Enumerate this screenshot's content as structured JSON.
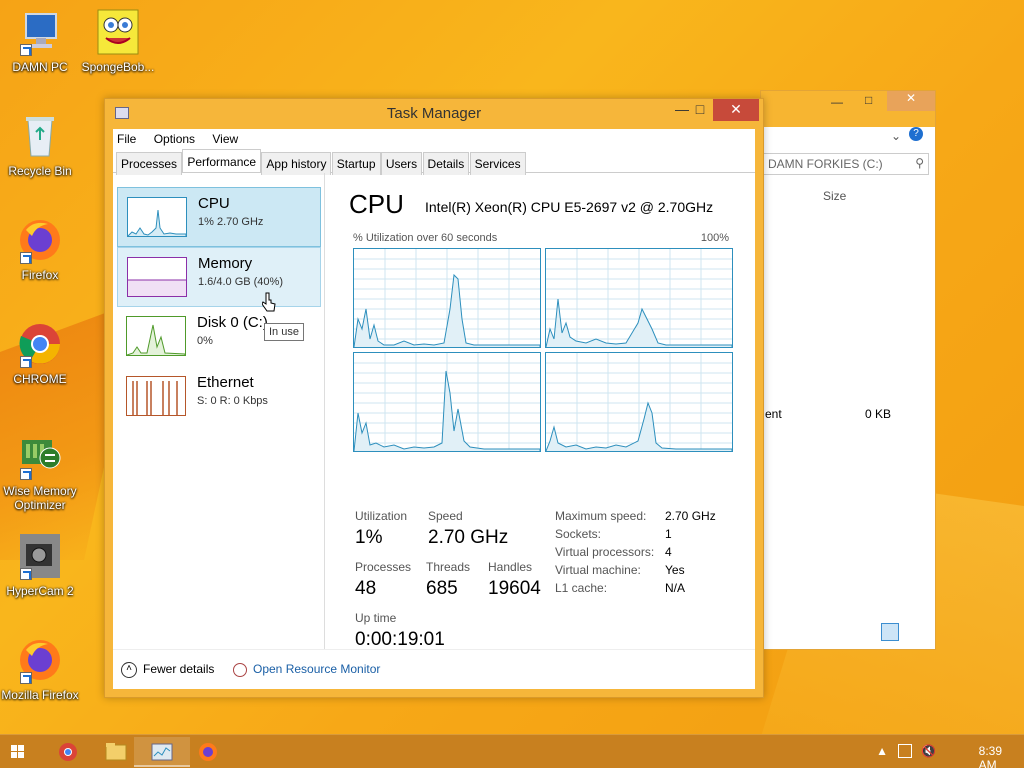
{
  "desktop": {
    "icons": [
      {
        "label": "DAMN PC",
        "icon": "computer-icon"
      },
      {
        "label": "SpongeBob...",
        "icon": "spongebob-icon"
      },
      {
        "label": "Recycle Bin",
        "icon": "recycle-bin-icon"
      },
      {
        "label": "Firefox",
        "icon": "firefox-icon"
      },
      {
        "label": "CHROME",
        "icon": "chrome-icon"
      },
      {
        "label": "Wise Memory Optimizer",
        "icon": "memory-optimizer-icon"
      },
      {
        "label": "HyperCam 2",
        "icon": "hypercam-icon"
      },
      {
        "label": "Mozilla Firefox",
        "icon": "firefox-icon"
      }
    ]
  },
  "explorer": {
    "address": "DAMN FORKIES (C:)",
    "col_size": "Size",
    "row_name_fragment": "ent",
    "row_size": "0 KB"
  },
  "task_manager": {
    "title": "Task Manager",
    "menu": [
      "File",
      "Options",
      "View"
    ],
    "tabs": [
      "Processes",
      "Performance",
      "App history",
      "Startup",
      "Users",
      "Details",
      "Services"
    ],
    "active_tab": "Performance",
    "resources": [
      {
        "name": "CPU",
        "detail": "1% 2.70 GHz"
      },
      {
        "name": "Memory",
        "detail": "1.6/4.0 GB (40%)"
      },
      {
        "name": "Disk 0 (C:)",
        "detail": "0%"
      },
      {
        "name": "Ethernet",
        "detail": "S: 0 R: 0 Kbps"
      }
    ],
    "tooltip": "In use",
    "cpu_panel": {
      "heading": "CPU",
      "model": "Intel(R) Xeon(R) CPU E5-2697 v2 @ 2.70GHz",
      "util_label": "% Utilization over 60 seconds",
      "max_label": "100%",
      "stats": {
        "utilization_label": "Utilization",
        "utilization": "1%",
        "speed_label": "Speed",
        "speed": "2.70 GHz",
        "processes_label": "Processes",
        "processes": "48",
        "threads_label": "Threads",
        "threads": "685",
        "handles_label": "Handles",
        "handles": "19604",
        "uptime_label": "Up time",
        "uptime": "0:00:19:01"
      },
      "details": [
        {
          "key": "Maximum speed:",
          "value": "2.70 GHz"
        },
        {
          "key": "Sockets:",
          "value": "1"
        },
        {
          "key": "Virtual processors:",
          "value": "4"
        },
        {
          "key": "Virtual machine:",
          "value": "Yes"
        },
        {
          "key": "L1 cache:",
          "value": "N/A"
        }
      ]
    },
    "footer": {
      "fewer_details": "Fewer details",
      "open_resource_monitor": "Open Resource Monitor"
    }
  },
  "taskbar": {
    "clock": "8:39 AM",
    "items": [
      "start-button",
      "chrome-icon",
      "file-explorer-icon",
      "task-manager-icon",
      "firefox-icon"
    ]
  }
}
